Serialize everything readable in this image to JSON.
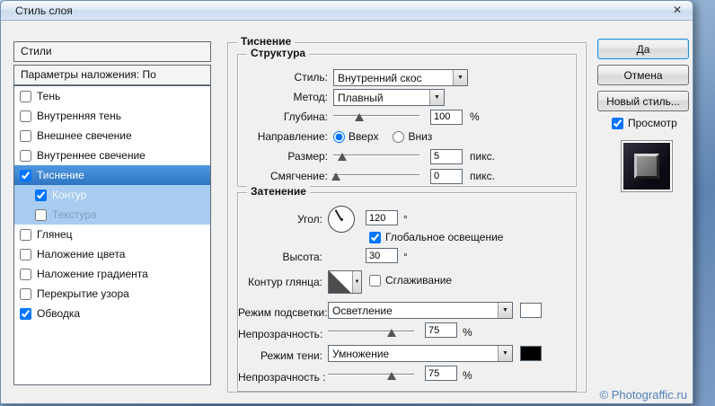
{
  "window": {
    "title": "Стиль слоя",
    "close_glyph": "✕"
  },
  "sidebar": {
    "styles_header": "Стили",
    "blending_options": "Параметры наложения: По умолчанию",
    "items": [
      {
        "label": "Тень",
        "checked": false
      },
      {
        "label": "Внутренняя тень",
        "checked": false
      },
      {
        "label": "Внешнее свечение",
        "checked": false
      },
      {
        "label": "Внутреннее свечение",
        "checked": false
      },
      {
        "label": "Тиснение",
        "checked": true,
        "selected": true
      },
      {
        "label": "Контур",
        "checked": true,
        "sub": true
      },
      {
        "label": "Текстура",
        "checked": false,
        "sub": true
      },
      {
        "label": "Глянец",
        "checked": false
      },
      {
        "label": "Наложение цвета",
        "checked": false
      },
      {
        "label": "Наложение градиента",
        "checked": false
      },
      {
        "label": "Перекрытие узора",
        "checked": false
      },
      {
        "label": "Обводка",
        "checked": true
      }
    ]
  },
  "main": {
    "title": "Тиснение",
    "structure": {
      "title": "Структура",
      "style_label": "Стиль:",
      "style_value": "Внутренний скос",
      "method_label": "Метод:",
      "method_value": "Плавный",
      "depth_label": "Глубина:",
      "depth_value": "100",
      "depth_unit": "%",
      "direction_label": "Направление:",
      "direction_up": "Вверх",
      "direction_down": "Вниз",
      "size_label": "Размер:",
      "size_value": "5",
      "size_unit": "пикс.",
      "soften_label": "Смягчение:",
      "soften_value": "0",
      "soften_unit": "пикс."
    },
    "shading": {
      "title": "Затенение",
      "angle_label": "Угол:",
      "angle_value": "120",
      "angle_unit": "°",
      "global_light_label": "Глобальное освещение",
      "altitude_label": "Высота:",
      "altitude_value": "30",
      "altitude_unit": "°",
      "gloss_contour_label": "Контур глянца:",
      "antialiased_label": "Сглаживание",
      "highlight_mode_label": "Режим подсветки:",
      "highlight_mode_value": "Осветление",
      "highlight_opacity_label": "Непрозрачность:",
      "highlight_opacity_value": "75",
      "highlight_opacity_unit": "%",
      "shadow_mode_label": "Режим тени:",
      "shadow_mode_value": "Умножение",
      "shadow_opacity_label": "Непрозрачность :",
      "shadow_opacity_value": "75",
      "shadow_opacity_unit": "%"
    }
  },
  "buttons": {
    "ok": "Да",
    "cancel": "Отмена",
    "new_style": "Новый стиль...",
    "preview": "Просмотр"
  },
  "watermark": "© Photograffic.ru",
  "colors": {
    "selection_blue": "#3c84d0",
    "selection_light_blue": "#a8cdf0",
    "highlight_swatch": "#ffffff",
    "shadow_swatch": "#000000",
    "default_button_border": "#2a8dd4"
  }
}
